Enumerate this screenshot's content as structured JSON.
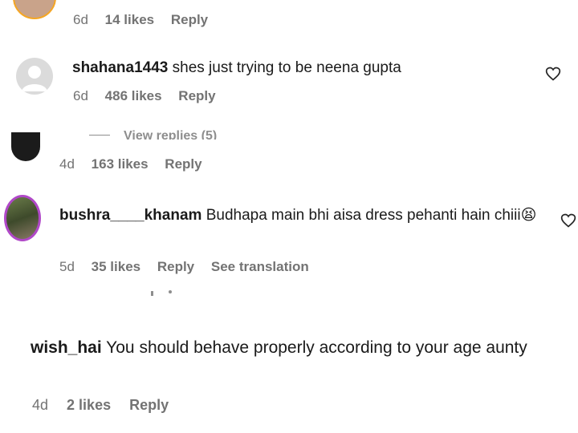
{
  "comments": [
    {
      "meta": {
        "time": "6d",
        "likes": "14 likes",
        "reply": "Reply"
      }
    },
    {
      "username": "shahana1443",
      "text": "shes just trying to be neena gupta",
      "meta": {
        "time": "6d",
        "likes": "486 likes",
        "reply": "Reply"
      },
      "view_replies": "View replies (5)"
    },
    {
      "meta": {
        "time": "4d",
        "likes": "163 likes",
        "reply": "Reply"
      }
    },
    {
      "username": "bushra____khanam",
      "text": "Budhapa main bhi aisa dress pehanti hain chiii😫",
      "meta": {
        "time": "5d",
        "likes": "35 likes",
        "reply": "Reply",
        "translate": "See translation"
      }
    },
    {
      "username": "wish_hai",
      "text": "You should behave properly according to your age aunty",
      "meta": {
        "time": "4d",
        "likes": "2 likes",
        "reply": "Reply"
      }
    }
  ],
  "colors": {
    "meta": "#737373",
    "text": "#1a1a1a",
    "background": "#ffffff",
    "accent_ring": "#e1306c"
  },
  "icons": [
    "heart-icon",
    "avatar-default-icon"
  ]
}
